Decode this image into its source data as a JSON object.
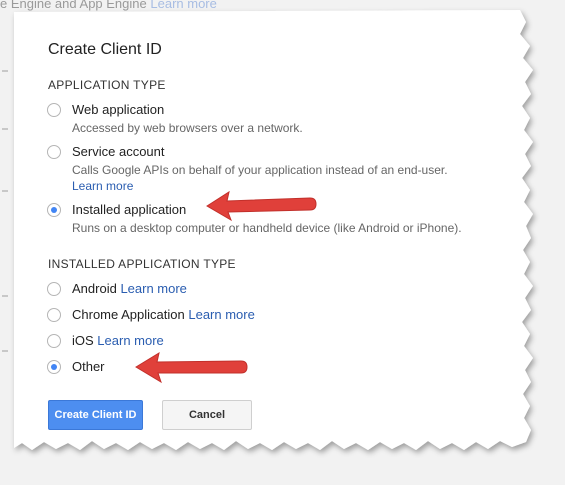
{
  "background": {
    "top_text": "e Engine and App Engine",
    "top_link": "Learn more"
  },
  "dialog": {
    "title": "Create Client ID",
    "application_type": {
      "heading": "APPLICATION TYPE",
      "options": [
        {
          "label": "Web application",
          "description": "Accessed by web browsers over a network.",
          "selected": false
        },
        {
          "label": "Service account",
          "description": "Calls Google APIs on behalf of your application instead of an end-user.",
          "link": "Learn more",
          "selected": false
        },
        {
          "label": "Installed application",
          "description": "Runs on a desktop computer or handheld device (like Android or iPhone).",
          "selected": true
        }
      ]
    },
    "installed_application_type": {
      "heading": "INSTALLED APPLICATION TYPE",
      "options": [
        {
          "label": "Android",
          "link": "Learn more",
          "selected": false
        },
        {
          "label": "Chrome Application",
          "link": "Learn more",
          "selected": false
        },
        {
          "label": "iOS",
          "link": "Learn more",
          "selected": false
        },
        {
          "label": "Other",
          "selected": true
        }
      ]
    },
    "buttons": {
      "create": "Create Client ID",
      "cancel": "Cancel"
    }
  },
  "colors": {
    "accent": "#4285f4",
    "primary_button": "#4d8ef0",
    "link": "#2a5db0",
    "annotation_arrow": "#e0403a"
  },
  "annotations": [
    "red-arrow",
    "red-arrow"
  ]
}
